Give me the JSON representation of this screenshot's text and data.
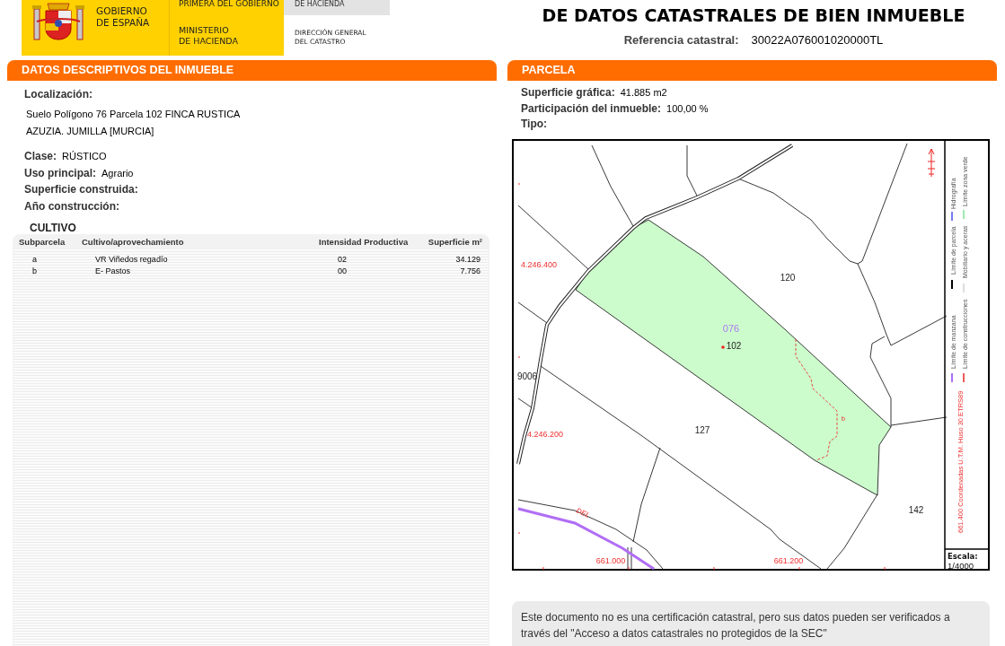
{
  "header": {
    "government": [
      "GOBIERNO",
      "DE ESPAÑA"
    ],
    "ministry_top": "PRIMERA DEL GOBIERNO",
    "ministry": [
      "MINISTERIO",
      "DE HACIENDA"
    ],
    "tab_label": "DE HACIENDA",
    "directorate": [
      "DIRECCIÓN GENERAL",
      "DEL CATASTRO"
    ]
  },
  "title": "DE DATOS CATASTRALES DE BIEN INMUEBLE",
  "reference": {
    "label": "Referencia catastral:",
    "value": "30022A076001020000TL"
  },
  "property": {
    "heading": "DATOS DESCRIPTIVOS DEL INMUEBLE",
    "location_label": "Localización:",
    "location_lines": [
      "Suelo Polígono 76 Parcela 102 FINCA RUSTICA",
      "AZUZIA. JUMILLA [MURCIA]"
    ],
    "fields": [
      {
        "label": "Clase:",
        "value": "RÚSTICO"
      },
      {
        "label": "Uso principal:",
        "value": "Agrario"
      },
      {
        "label": "Superficie construida:"
      },
      {
        "label": "Año construcción:"
      }
    ],
    "crops": {
      "heading": "CULTIVO",
      "columns": [
        "Subparcela",
        "Cultivo/aprovechamiento",
        "Intensidad Productiva",
        "Superficie m²"
      ],
      "rows": [
        [
          "a",
          "VR Viñedos regadío",
          "02",
          "34.129"
        ],
        [
          "b",
          "E- Pastos",
          "00",
          "7.756"
        ]
      ]
    }
  },
  "parcel": {
    "heading": "PARCELA",
    "fields": [
      {
        "label": "Superficie gráfica:",
        "value": "41.885 m2"
      },
      {
        "label": "Participación del inmueble:",
        "value": "100,00 %"
      },
      {
        "label": "Tipo:"
      }
    ],
    "map": {
      "labels": [
        {
          "text": "120",
          "kind": "parcel"
        },
        {
          "text": "076",
          "kind": "polygon"
        },
        {
          "text": "102",
          "kind": "parcel"
        },
        {
          "text": "9006",
          "kind": "parcel"
        },
        {
          "text": "127",
          "kind": "parcel"
        },
        {
          "text": "142",
          "kind": "parcel"
        },
        {
          "text": "b",
          "kind": "subparcel"
        },
        {
          "text": "4.246.400",
          "kind": "coordinate"
        },
        {
          "text": "4.246.200",
          "kind": "coordinate"
        },
        {
          "text": "661.000",
          "kind": "coordinate"
        },
        {
          "text": "661.200",
          "kind": "coordinate"
        },
        {
          "text": "DEL",
          "kind": "road"
        }
      ],
      "legend": [
        {
          "text": "Límite de manzana",
          "color": "#b06ef5"
        },
        {
          "text": "Límite de parcela",
          "color": "#000000"
        },
        {
          "text": "Hidrografía",
          "color": "#7b7bf0"
        },
        {
          "text": "Límite de construcciones",
          "color": "#f05a5a"
        },
        {
          "text": "Mobiliario y aceras",
          "color": "#dddddd"
        },
        {
          "text": "Límite zona verde",
          "color": "#9fe8b0"
        }
      ],
      "projection": "661.400 Coordenadas U.T.M. Huso 30 ETRS89",
      "scale_label": "Escala:",
      "scale": "1/4000"
    }
  },
  "note": "Este documento no es una certificación catastral, pero sus datos pueden ser verificados a través del \"Acceso a datos catastrales no protegidos de la SEC\""
}
